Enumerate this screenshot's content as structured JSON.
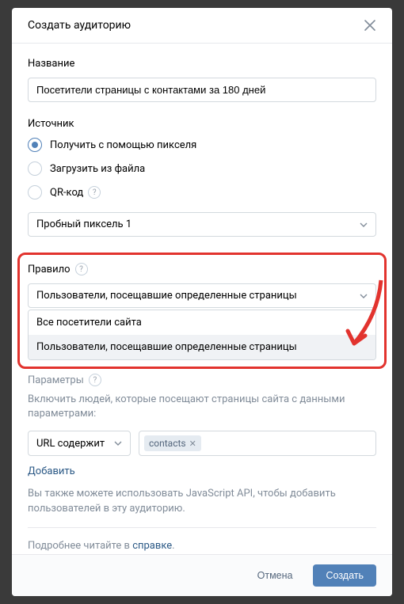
{
  "header": {
    "title": "Создать аудиторию"
  },
  "name": {
    "label": "Название",
    "value": "Посетители страницы с контактами за 180 дней"
  },
  "source": {
    "label": "Источник",
    "options": [
      {
        "label": "Получить с помощью пикселя",
        "selected": true
      },
      {
        "label": "Загрузить из файла",
        "selected": false
      },
      {
        "label": "QR-код",
        "selected": false
      }
    ],
    "pixel_selected": "Пробный пиксель 1"
  },
  "rule": {
    "label": "Правило",
    "selected": "Пользователи, посещавшие определенные страницы",
    "options": [
      "Все посетители сайта",
      "Пользователи, посещавшие определенные страницы"
    ]
  },
  "params": {
    "label": "Параметры",
    "description": "Включить людей, которые посещают страницы сайта с данными параметрами:",
    "condition": "URL содержит",
    "tags": [
      "contacts"
    ],
    "add_link": "Добавить",
    "js_note": "Вы также можете использовать JavaScript API, чтобы добавить пользователей в эту аудиторию."
  },
  "help": {
    "prefix": "Подробнее читайте в ",
    "link_text": "справке"
  },
  "footer": {
    "cancel": "Отмена",
    "create": "Создать"
  }
}
